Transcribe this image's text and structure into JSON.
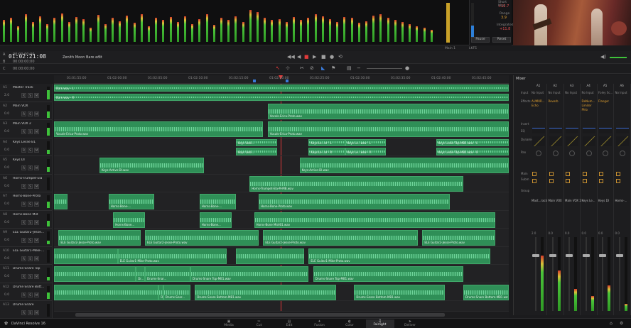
{
  "meter_bridge": {
    "levels": [
      0.55,
      0.6,
      0.4,
      0.7,
      0.5,
      0.65,
      0.45,
      0.6,
      0.72,
      0.5,
      0.62,
      0.58,
      0.35,
      0.68,
      0.44,
      0.6,
      0.52,
      0.66,
      0.48,
      0.7,
      0.4,
      0.6,
      0.55,
      0.62,
      0.5,
      0.64,
      0.45,
      0.58,
      0.7,
      0.42,
      0.6,
      0.56,
      0.65,
      0.5,
      0.8,
      0.75,
      0.6,
      0.55,
      0.58,
      0.5,
      0.62,
      0.55,
      0.6,
      0.7,
      0.65,
      0.58,
      0.5,
      0.62,
      0.6,
      0.48,
      0.52,
      0.66,
      0.7,
      0.6,
      0.55,
      0.5,
      0.45,
      0.4,
      0.35,
      0.3
    ]
  },
  "loudness": {
    "short_max_label": "Short Max",
    "short_max_value": "+12.7",
    "range_label": "Range",
    "range_value": "3.9",
    "integrated_label": "Integrated",
    "integrated_value": "+11.8",
    "pause_label": "Pause",
    "reset_label": "Reset",
    "meter_label": "Main 1",
    "format_label": "LKFS"
  },
  "timecode": {
    "main": "01:02:21:08",
    "timeline_name": "Zenith Moon Bare edit",
    "rows": [
      {
        "id": "A",
        "val": "00:00:00:00"
      },
      {
        "id": "B",
        "val": "00:00:00:00"
      },
      {
        "id": "C",
        "val": "00:00:00:00"
      }
    ]
  },
  "ruler": {
    "ticks": [
      "01:01:55:00",
      "01:02:00:00",
      "01:02:05:00",
      "01:02:10:00",
      "01:02:15:00",
      "01:02:20:00",
      "01:02:25:00",
      "01:02:30:00",
      "01:02:35:00",
      "01:02:40:00",
      "01:02:45:00"
    ]
  },
  "tracks": [
    {
      "id": "A1",
      "name": "Master Track",
      "vol": "2.0",
      "meter": 0.7
    },
    {
      "id": "A2",
      "name": "Main VOX",
      "vol": "0.0",
      "meter": 0.5
    },
    {
      "id": "A3",
      "name": "Main VOX 2",
      "vol": "0.0",
      "meter": 0.6
    },
    {
      "id": "A4",
      "name": "Keys Leslie B1",
      "vol": "0.0",
      "meter": 0.3
    },
    {
      "id": "A5",
      "name": "Keys DI",
      "vol": "0.0",
      "meter": 0.4
    },
    {
      "id": "A6",
      "name": "Horns-Trumpet-Ela",
      "vol": "0.0",
      "meter": 0.0
    },
    {
      "id": "A7",
      "name": "Horns-Bone-Proto",
      "vol": "0.0",
      "meter": 0.5
    },
    {
      "id": "A8",
      "name": "Horns-Bone Mid",
      "vol": "0.0",
      "meter": 0.4
    },
    {
      "id": "A9",
      "name": "ELE Guitar2-Jesse...",
      "vol": "0.0",
      "meter": 0.3
    },
    {
      "id": "A10",
      "name": "ELE Guitar1-Mike-...",
      "vol": "0.0",
      "meter": 0.0
    },
    {
      "id": "A11",
      "name": "Drums-Snare Top",
      "vol": "0.0",
      "meter": 0.3
    },
    {
      "id": "A12",
      "name": "Drums-Snare Bott...",
      "vol": "0.0",
      "meter": 0.5
    },
    {
      "id": "A13",
      "name": "Drums-Snare",
      "vol": "",
      "meter": 0.0
    }
  ],
  "track_buttons": [
    "R",
    "S",
    "M"
  ],
  "clips": [
    [
      {
        "label": "Bare.wav - L",
        "s": 0.0,
        "e": 1.0,
        "h": 0.45,
        "top": 0
      },
      {
        "label": "Bare.wav - R",
        "s": 0.0,
        "e": 1.0,
        "h": 0.45,
        "top": 0.5
      }
    ],
    [
      {
        "label": "Vocals-Erica-Proto.wav",
        "s": 0.47,
        "e": 1.0,
        "h": 0.9,
        "top": 0.05
      }
    ],
    [
      {
        "label": "Vocals-Erica-Proto.wav",
        "s": 0.0,
        "e": 0.46,
        "h": 0.9,
        "top": 0.05
      },
      {
        "label": "Vocals-Erica-Proto.wav",
        "s": 0.47,
        "e": 1.0,
        "h": 0.9,
        "top": 0.05
      }
    ],
    [
      {
        "label": "Keys Lesli...",
        "s": 0.4,
        "e": 0.49,
        "h": 0.45,
        "top": 0
      },
      {
        "label": "Keys Lesli...",
        "s": 0.4,
        "e": 0.49,
        "h": 0.45,
        "top": 0.5
      },
      {
        "label": "Keys Le...ar - L",
        "s": 0.56,
        "e": 0.64,
        "h": 0.45,
        "top": 0
      },
      {
        "label": "Keys Le...ar - R",
        "s": 0.56,
        "e": 0.64,
        "h": 0.45,
        "top": 0.5
      },
      {
        "label": "Keys Le...wav - L",
        "s": 0.64,
        "e": 0.73,
        "h": 0.45,
        "top": 0
      },
      {
        "label": "Keys Le...wav - R",
        "s": 0.64,
        "e": 0.73,
        "h": 0.45,
        "top": 0.5
      },
      {
        "label": "Keys Leslie Top-MB1.wav - L",
        "s": 0.84,
        "e": 1.0,
        "h": 0.45,
        "top": 0
      },
      {
        "label": "Keys Leslie Top-MB1.wav - R",
        "s": 0.84,
        "e": 1.0,
        "h": 0.45,
        "top": 0.5
      }
    ],
    [
      {
        "label": "Keys-Active-DI.wav",
        "s": 0.1,
        "e": 0.33,
        "h": 0.9,
        "top": 0.05
      },
      {
        "label": "Keys-Active-DI.wav",
        "s": 0.54,
        "e": 1.0,
        "h": 0.9,
        "top": 0.05
      }
    ],
    [
      {
        "label": "Horns-Trumpet-Ela-M-MB.wav",
        "s": 0.43,
        "e": 0.9,
        "h": 0.9,
        "top": 0.05
      }
    ],
    [
      {
        "label": "",
        "s": 0.0,
        "e": 0.03,
        "h": 0.9,
        "top": 0.05
      },
      {
        "label": "Horns-Bone-...",
        "s": 0.12,
        "e": 0.22,
        "h": 0.9,
        "top": 0.05
      },
      {
        "label": "Horns-Bone-...",
        "s": 0.32,
        "e": 0.4,
        "h": 0.9,
        "top": 0.05
      },
      {
        "label": "Horns-Bone-Proto.wav",
        "s": 0.45,
        "e": 0.87,
        "h": 0.9,
        "top": 0.05
      }
    ],
    [
      {
        "label": "Horns-Bone...",
        "s": 0.13,
        "e": 0.2,
        "h": 0.9,
        "top": 0.05
      },
      {
        "label": "Horns-Bone...",
        "s": 0.32,
        "e": 0.39,
        "h": 0.9,
        "top": 0.05
      },
      {
        "label": "Horns-Bone Mid-B1.wav",
        "s": 0.44,
        "e": 0.97,
        "h": 0.9,
        "top": 0.05
      }
    ],
    [
      {
        "label": "ELE Guitar2-Jesse-Proto.wav",
        "s": 0.01,
        "e": 0.19,
        "h": 0.9,
        "top": 0.05
      },
      {
        "label": "ELE Guitar2-Jesse-Proto.wav",
        "s": 0.2,
        "e": 0.45,
        "h": 0.9,
        "top": 0.05
      },
      {
        "label": "ELE Guitar2-Jesse-Proto.wav",
        "s": 0.46,
        "e": 0.8,
        "h": 0.9,
        "top": 0.05
      },
      {
        "label": "ELE Guitar2-Jesse-Proto.wav",
        "s": 0.81,
        "e": 0.97,
        "h": 0.9,
        "top": 0.05
      }
    ],
    [
      {
        "label": "",
        "s": 0.0,
        "e": 0.14,
        "h": 0.9,
        "top": 0.05
      },
      {
        "label": "ELE Guitar1-Mike-Proto.wav",
        "s": 0.14,
        "e": 0.38,
        "h": 0.9,
        "top": 0.05
      },
      {
        "label": "",
        "s": 0.4,
        "e": 0.55,
        "h": 0.9,
        "top": 0.05
      },
      {
        "label": "ELE Guitar1-Mike-Proto.wav",
        "s": 0.56,
        "e": 0.96,
        "h": 0.9,
        "top": 0.05
      }
    ],
    [
      {
        "label": "",
        "s": 0.0,
        "e": 0.18,
        "h": 0.9,
        "top": 0.05
      },
      {
        "label": "Dr...",
        "s": 0.18,
        "e": 0.2,
        "h": 0.9,
        "top": 0.05
      },
      {
        "label": "Drums-Snar...",
        "s": 0.2,
        "e": 0.3,
        "h": 0.9,
        "top": 0.05
      },
      {
        "label": "Drums-Snare Top-MB1.wav",
        "s": 0.3,
        "e": 0.56,
        "h": 0.9,
        "top": 0.05
      },
      {
        "label": "Drums-Snare Top-MB1.wav",
        "s": 0.57,
        "e": 0.9,
        "h": 0.9,
        "top": 0.05
      }
    ],
    [
      {
        "label": "",
        "s": 0.0,
        "e": 0.23,
        "h": 0.9,
        "top": 0.05
      },
      {
        "label": "Dr...",
        "s": 0.23,
        "e": 0.24,
        "h": 0.9,
        "top": 0.05
      },
      {
        "label": "Drums-Snar...",
        "s": 0.24,
        "e": 0.3,
        "h": 0.9,
        "top": 0.05
      },
      {
        "label": "Drums-Snare Bottom-MB1.wav",
        "s": 0.31,
        "e": 0.62,
        "h": 0.9,
        "top": 0.05
      },
      {
        "label": "Drums-Snare Bottom-MB1.wav",
        "s": 0.66,
        "e": 0.86,
        "h": 0.9,
        "top": 0.05
      },
      {
        "label": "Drums-Snare Bottom-MB1.wav",
        "s": 0.9,
        "e": 1.0,
        "h": 0.9,
        "top": 0.05
      }
    ],
    []
  ],
  "mixer": {
    "title": "Mixer",
    "row_labels": [
      "Input",
      "Effects",
      "Insert",
      "EQ",
      "Dynamics",
      "Pan",
      "Main",
      "Subm",
      "Group"
    ],
    "channels": [
      {
        "id": "A1",
        "input": "No Input",
        "fx": [
          "AUMUR...",
          "Echo"
        ],
        "name": "Mast...rack",
        "vol": "2.0",
        "meter": 0.75
      },
      {
        "id": "A2",
        "input": "No Input",
        "fx": [
          "Reverb"
        ],
        "name": "Main VOX",
        "vol": "0.0",
        "meter": 0.55
      },
      {
        "id": "A3",
        "input": "No Input",
        "fx": [],
        "name": "Main VOX 2",
        "vol": "0.0",
        "meter": 0.3
      },
      {
        "id": "A4",
        "input": "No Input",
        "fx": [
          "DeNum...",
          "Limiter",
          "Phlo"
        ],
        "name": "Keys Le...",
        "vol": "0.0",
        "meter": 0.2
      },
      {
        "id": "A5",
        "input": "Foley Sc...",
        "fx": [
          "Flanger"
        ],
        "name": "Keys DI",
        "vol": "0.0",
        "meter": 0.35
      },
      {
        "id": "A6",
        "input": "No Input",
        "fx": [],
        "name": "Horns-...",
        "vol": "0.0",
        "meter": 0.1
      }
    ]
  },
  "pages": [
    {
      "icon": "▣",
      "label": "Media"
    },
    {
      "icon": "✂",
      "label": "Cut"
    },
    {
      "icon": "▤",
      "label": "Edit"
    },
    {
      "icon": "✦",
      "label": "Fusion"
    },
    {
      "icon": "◐",
      "label": "Color"
    },
    {
      "icon": "♫",
      "label": "Fairlight"
    },
    {
      "icon": "➤",
      "label": "Deliver"
    }
  ],
  "active_page": 5,
  "app_name": "DaVinci Resolve 16",
  "colors": {
    "clip": "#2f8f57",
    "clip_border": "#41a86a",
    "playhead": "#e03a3a",
    "accent_orange": "#e0a030"
  }
}
